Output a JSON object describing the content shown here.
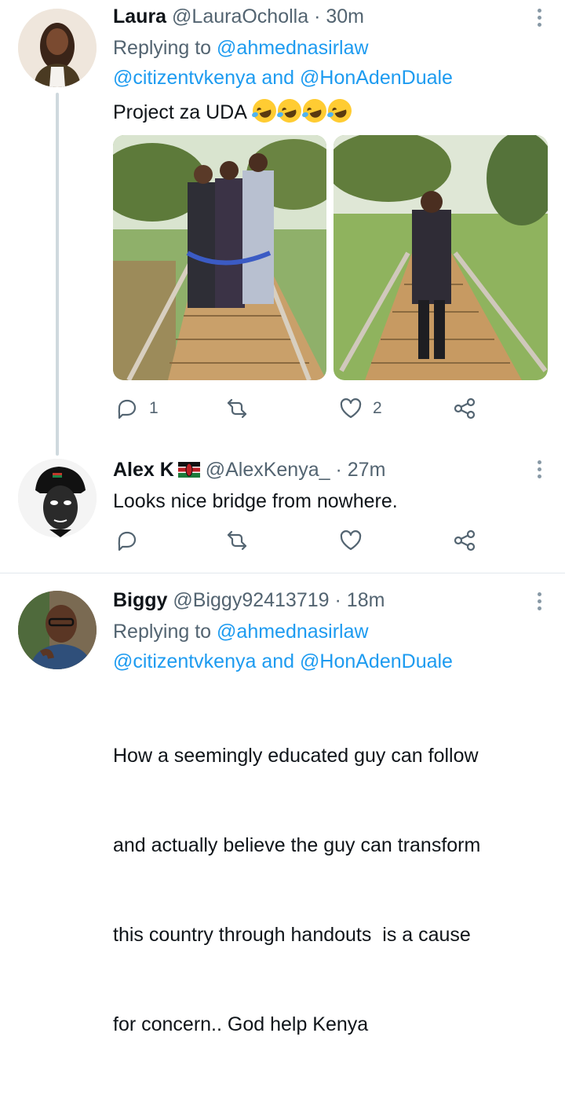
{
  "tweets": [
    {
      "name": "Laura",
      "handle": "@LauraOcholla",
      "time": "· 30m",
      "replying_label": "Replying to",
      "replying_mention1": "@ahmednasirlaw",
      "replying_mention2": "@citizentvkenya",
      "replying_and": " and ",
      "replying_mention3": "@HonAdenDuale",
      "text": "Project za UDA",
      "emoji_names": [
        "rolling-on-floor-laughing-emoji",
        "rolling-on-floor-laughing-emoji",
        "rolling-on-floor-laughing-emoji",
        "rolling-on-floor-laughing-emoji"
      ],
      "reply_count": "1",
      "retweet_count": "",
      "like_count": "2"
    },
    {
      "name": "Alex K",
      "flag": "kenya-flag-icon",
      "handle": "@AlexKenya_",
      "time": "· 27m",
      "text": "Looks nice bridge from nowhere.",
      "reply_count": "",
      "retweet_count": "",
      "like_count": ""
    },
    {
      "name": "Biggy",
      "handle": "@Biggy92413719",
      "time": "· 18m",
      "replying_label": "Replying to",
      "replying_mention1": "@ahmednasirlaw",
      "replying_mention2": "@citizentvkenya",
      "replying_and": " and ",
      "replying_mention3": "@HonAdenDuale",
      "text_lines": [
        "How a seemingly educated guy can follow",
        "and actually believe the guy can transform",
        "this country through handouts  is a cause",
        "for concern.. God help Kenya"
      ]
    }
  ],
  "icons": {
    "reply": "reply-icon",
    "retweet": "retweet-icon",
    "like": "like-icon",
    "share": "share-icon",
    "more": "more-options-icon"
  },
  "colors": {
    "link": "#1d9bf0",
    "secondary": "#536471",
    "primary": "#0f1419"
  }
}
